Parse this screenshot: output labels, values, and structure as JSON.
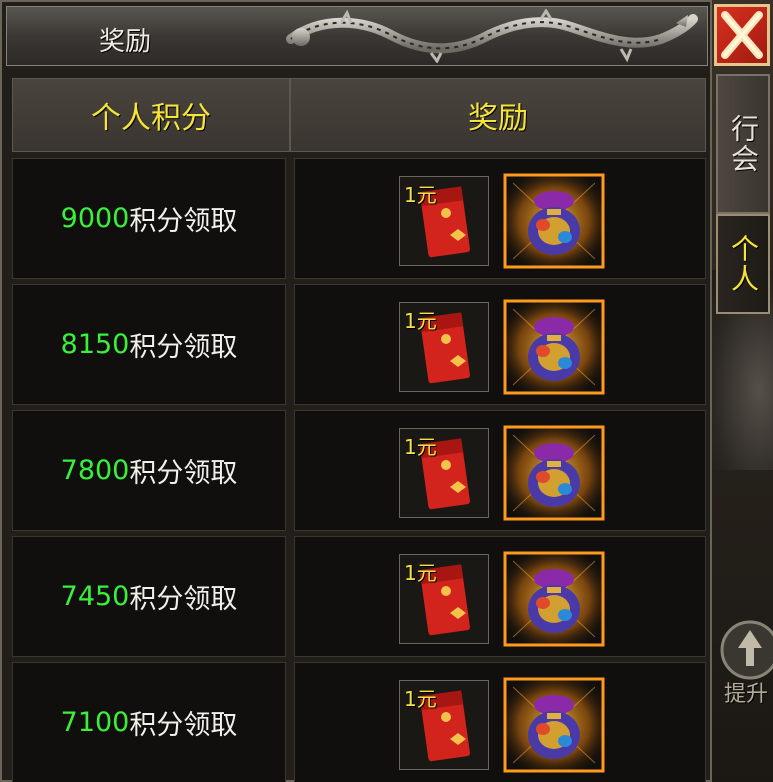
{
  "window": {
    "title": "奖励"
  },
  "table": {
    "headers": [
      "个人积分",
      "奖励"
    ],
    "rows": [
      {
        "points": "9000",
        "suffix": "积分领取",
        "reward_amount": "1元"
      },
      {
        "points": "8150",
        "suffix": "积分领取",
        "reward_amount": "1元"
      },
      {
        "points": "7800",
        "suffix": "积分领取",
        "reward_amount": "1元"
      },
      {
        "points": "7450",
        "suffix": "积分领取",
        "reward_amount": "1元"
      },
      {
        "points": "7100",
        "suffix": "积分领取",
        "reward_amount": "1元"
      }
    ]
  },
  "side_tabs": {
    "guild": "行会",
    "personal": "个人",
    "upgrade": "提升"
  },
  "icons": {
    "close": "close-icon",
    "red_packet": "red-envelope-icon",
    "treasure_bag": "treasure-bag-icon",
    "upgrade_arrow": "arrow-up-icon",
    "dragon": "dragon-ornament-icon"
  },
  "colors": {
    "points_green": "#39f03a",
    "header_yellow": "#f5e53a",
    "close_red": "#d93020"
  }
}
